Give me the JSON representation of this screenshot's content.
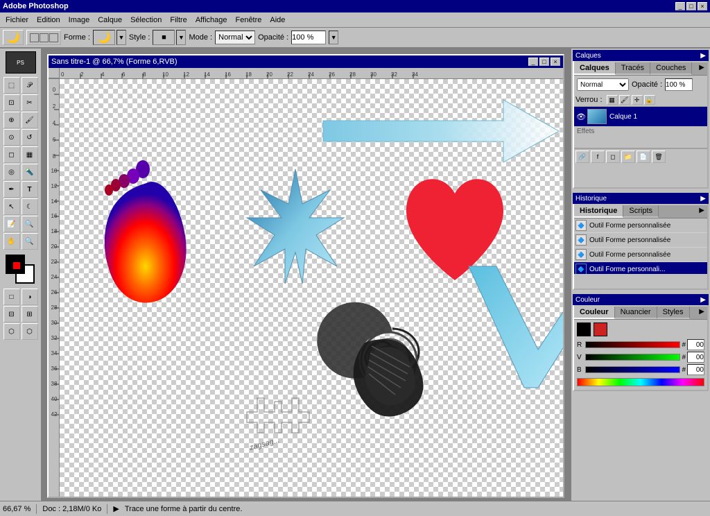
{
  "app": {
    "title": "Adobe Photoshop",
    "win_controls": [
      "_",
      "□",
      "×"
    ]
  },
  "menu": {
    "items": [
      "Fichier",
      "Edition",
      "Image",
      "Calque",
      "Sélection",
      "Filtre",
      "Affichage",
      "Fenêtre",
      "Aide"
    ]
  },
  "options_bar": {
    "forme_label": "Forme :",
    "style_label": "Style :",
    "mode_label": "Mode :",
    "mode_value": "Normal",
    "opacity_label": "Opacité :",
    "opacity_value": "100 %"
  },
  "panels": {
    "layers": {
      "title": "Calques",
      "tabs": [
        "Calques",
        "Tracés",
        "Couches"
      ],
      "active_tab": "Calques",
      "mode": "Normal",
      "opacity_label": "Opacité :",
      "opacity_value": "100 %",
      "lock_label": "Verrou :",
      "fx_label": "Effets",
      "items": [
        {
          "name": "Calque 1",
          "visible": true,
          "active": true
        }
      ]
    },
    "history": {
      "title": "Historique",
      "tabs": [
        "Historique",
        "Scripts"
      ],
      "active_tab": "Historique",
      "items": [
        "Outil Forme personnalisée",
        "Outil Forme personnalisée",
        "Outil Forme personnalisée",
        "Outil Forme personnali..."
      ]
    },
    "color": {
      "title": "Couleur",
      "tabs": [
        "Couleur",
        "Nuancier",
        "Styles"
      ],
      "active_tab": "Couleur",
      "r_label": "R",
      "g_label": "V",
      "b_label": "B",
      "r_value": "00",
      "g_value": "00",
      "b_value": "00"
    }
  },
  "document": {
    "title": "Sans titre-1 @ 66,7% (Forme 6,RVB)",
    "controls": [
      "_",
      "□",
      "×"
    ]
  },
  "status_bar": {
    "zoom": "66,67 %",
    "doc_info": "Doc : 2,18M/0 Ko",
    "hint": "Trace une forme à partir du centre."
  },
  "traces_tab": "Tracés"
}
